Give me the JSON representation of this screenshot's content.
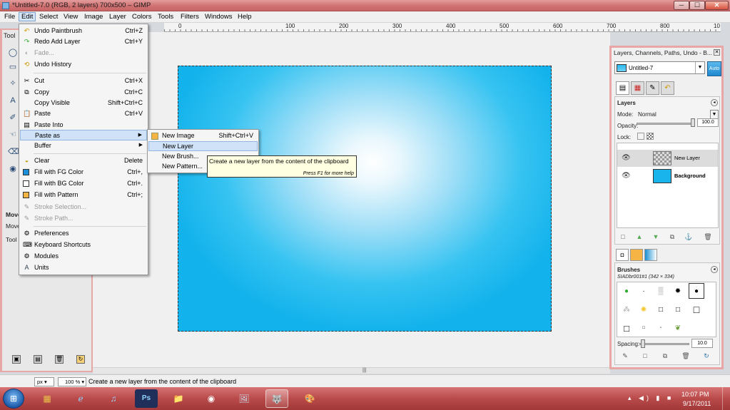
{
  "window": {
    "title": "*Untitled-7.0 (RGB, 2 layers) 700x500 – GIMP",
    "min": "─",
    "max": "☐",
    "close": "✕"
  },
  "menubar": [
    "File",
    "Edit",
    "Select",
    "View",
    "Image",
    "Layer",
    "Colors",
    "Tools",
    "Filters",
    "Windows",
    "Help"
  ],
  "ruler": {
    "labels": [
      "0",
      "100",
      "200",
      "300",
      "400",
      "500",
      "600",
      "700",
      "800",
      "900",
      "10"
    ]
  },
  "edit_menu": {
    "items": [
      {
        "label": "Undo Paintbrush",
        "shortcut": "Ctrl+Z",
        "icon": "↶"
      },
      {
        "label": "Redo Add Layer",
        "shortcut": "Ctrl+Y",
        "icon": "↷"
      },
      {
        "label": "Fade...",
        "shortcut": "",
        "icon": "◐"
      },
      {
        "label": "Undo History",
        "shortcut": "",
        "icon": "⟲"
      },
      {
        "label": "Cut",
        "shortcut": "Ctrl+X",
        "icon": "✂"
      },
      {
        "label": "Copy",
        "shortcut": "Ctrl+C",
        "icon": "⧉"
      },
      {
        "label": "Copy Visible",
        "shortcut": "Shift+Ctrl+C",
        "icon": ""
      },
      {
        "label": "Paste",
        "shortcut": "Ctrl+V",
        "icon": "📋"
      },
      {
        "label": "Paste Into",
        "shortcut": "",
        "icon": "▤"
      },
      {
        "label": "Paste as",
        "shortcut": "",
        "icon": ""
      },
      {
        "label": "Buffer",
        "shortcut": "",
        "icon": ""
      },
      {
        "label": "Clear",
        "shortcut": "Delete",
        "icon": "◒"
      },
      {
        "label": "Fill with FG Color",
        "shortcut": "Ctrl+,",
        "icon": ""
      },
      {
        "label": "Fill with BG Color",
        "shortcut": "Ctrl+.",
        "icon": ""
      },
      {
        "label": "Fill with Pattern",
        "shortcut": "Ctrl+;",
        "icon": ""
      },
      {
        "label": "Stroke Selection...",
        "shortcut": "",
        "icon": "✎"
      },
      {
        "label": "Stroke Path...",
        "shortcut": "",
        "icon": "✎"
      },
      {
        "label": "Preferences",
        "shortcut": "",
        "icon": "⚙"
      },
      {
        "label": "Keyboard Shortcuts",
        "shortcut": "",
        "icon": "⌨"
      },
      {
        "label": "Modules",
        "shortcut": "",
        "icon": "⚙"
      },
      {
        "label": "Units",
        "shortcut": "",
        "icon": "A"
      }
    ]
  },
  "paste_as_menu": {
    "items": [
      {
        "label": "New Image",
        "shortcut": "Shift+Ctrl+V"
      },
      {
        "label": "New Layer",
        "shortcut": ""
      },
      {
        "label": "New Brush...",
        "shortcut": ""
      },
      {
        "label": "New Pattern...",
        "shortcut": ""
      }
    ]
  },
  "tooltip": {
    "text": "Create a new layer from the content of the clipboard",
    "help": "Press F1 for more help"
  },
  "toolbox": {
    "title": "Tool",
    "move_label": "Move",
    "move_sub": "Move",
    "tool_label": "Tool"
  },
  "dock": {
    "title": "Layers, Channels, Paths, Undo - B...",
    "close": "✕",
    "image_name": "Untitled-7",
    "auto": "Auto",
    "layers_title": "Layers",
    "mode_label": "Mode:",
    "mode_value": "Normal",
    "opacity_label": "Opacity:",
    "opacity_value": "100.0",
    "lock_label": "Lock:",
    "layers": [
      {
        "name": "New Layer"
      },
      {
        "name": "Background"
      }
    ],
    "brushes_title": "Brushes",
    "brush_name": "SIADbr001#1 (342 × 334)",
    "spacing_label": "Spacing:",
    "spacing_value": "10.0"
  },
  "statusbar": {
    "unit": "px",
    "zoom": "100 %",
    "message": "Create a new layer from the content of the clipboard"
  },
  "taskbar": {
    "time": "10:07 PM",
    "date": "9/17/2011"
  },
  "colors": {
    "image_center": "#ffffff",
    "image_edge": "#12b2ec",
    "accent": "#cfe2f7"
  }
}
